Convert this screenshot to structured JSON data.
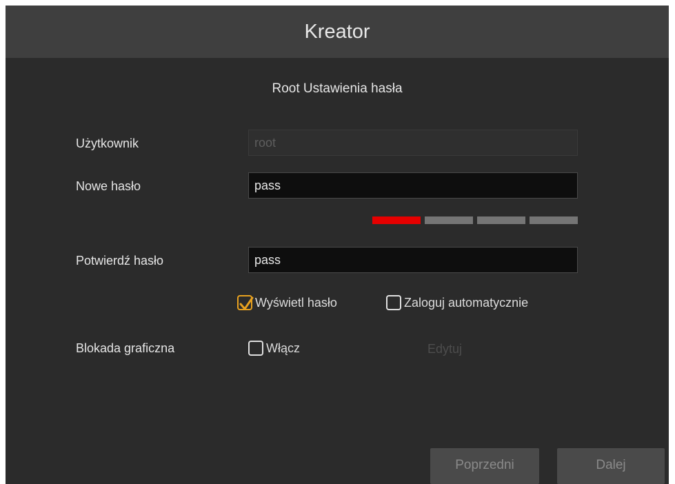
{
  "dialog": {
    "title": "Kreator",
    "subtitle": "Root Ustawienia hasła"
  },
  "form": {
    "user_label": "Użytkownik",
    "user_value": "root",
    "new_password_label": "Nowe hasło",
    "new_password_value": "pass",
    "password_strength_level": "1/4",
    "confirm_password_label": "Potwierdź hasło",
    "confirm_password_value": "pass",
    "show_password_label": "Wyświetl hasło",
    "show_password_checked": true,
    "auto_login_label": "Zaloguj automatycznie",
    "auto_login_checked": false,
    "pattern_lock_label": "Blokada graficzna",
    "enable_label": "Włącz",
    "enable_checked": false,
    "edit_label": "Edytuj"
  },
  "buttons": {
    "previous": "Poprzedni",
    "next": "Dalej"
  },
  "colors": {
    "strength_active": "#e60000",
    "strength_inactive": "#757575",
    "checkbox_accent": "#e8a11f"
  }
}
